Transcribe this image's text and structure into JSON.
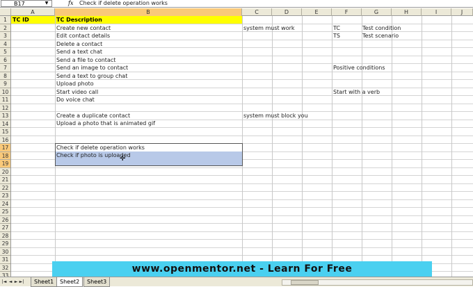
{
  "formula_bar": {
    "name_box": "B17",
    "fx_label": "fx",
    "formula": "Check if delete operation works",
    "dropdown_glyph": "▼"
  },
  "columns": [
    "A",
    "B",
    "C",
    "D",
    "E",
    "F",
    "G",
    "H",
    "I",
    "J"
  ],
  "selected_column": "B",
  "rows": [
    "1",
    "2",
    "3",
    "4",
    "5",
    "6",
    "7",
    "8",
    "9",
    "10",
    "11",
    "12",
    "13",
    "14",
    "15",
    "16",
    "17",
    "18",
    "19",
    "20",
    "21",
    "22",
    "23",
    "24",
    "25",
    "26",
    "27",
    "28",
    "29",
    "30",
    "31",
    "32",
    "33"
  ],
  "selected_rows": [
    "17",
    "18",
    "19"
  ],
  "cells": {
    "A1": "TC ID",
    "B1": "TC Description",
    "B2": "Create new contact",
    "B3": "Edit contact details",
    "B4": "Delete a contact",
    "B5": "Send a text chat",
    "B6": "Send a file to contact",
    "B7": "Send an image to contact",
    "B8": "Send a text to group chat",
    "B9": "Upload photo",
    "B10": "Start video call",
    "B11": "Do voice chat",
    "B13": "Create a duplicate contact",
    "B14": "Upload a photo that is animated gif",
    "B17": "Check if delete operation works",
    "B18": "Check if photo is uploaded",
    "C2": "system must work",
    "C13": "system must block you",
    "F2": "TC",
    "G2": "Test condition",
    "F3": "TS",
    "G3": "Test scenario",
    "F7": "Positive conditions",
    "F10": "Start with a verb"
  },
  "banner": {
    "text": "www.openmentor.net   -   Learn For Free",
    "color": "#4ad0f0"
  },
  "sheet_tabs": [
    "Sheet1",
    "Sheet2",
    "Sheet3"
  ],
  "active_sheet": "Sheet2",
  "nav_buttons": [
    "|◄",
    "◄",
    "►",
    "►|"
  ],
  "colors": {
    "header_row_fill": "#ffff00",
    "selection_fill": "#b8c9e8",
    "header_highlight": "#f9c97a"
  }
}
